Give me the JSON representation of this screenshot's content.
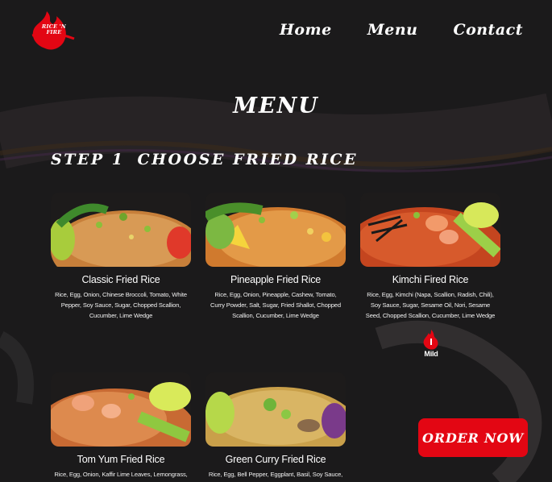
{
  "brand": {
    "logo_text": "RICE 'N FIRE",
    "accent": "#e30613"
  },
  "nav": {
    "items": [
      "Home",
      "Menu",
      "Contact"
    ]
  },
  "page_title": "Menu",
  "step": {
    "number": "Step 1",
    "title": "Choose Fried Rice"
  },
  "cards": [
    {
      "name": "Classic Fried Rice",
      "ingredients": "Rice, Egg, Onion, Chinese Broccoli, Tomato, White Pepper, Soy Sauce, Sugar, Chopped Scallion, Cucumber, Lime Wedge"
    },
    {
      "name": "Pineapple Fried Rice",
      "ingredients": "Rice, Egg, Onion, Pineapple, Cashew, Tomato, Curry Powder, Salt, Sugar, Fried Shallot, Chopped Scallion, Cucumber, Lime Wedge"
    },
    {
      "name": "Kimchi Fired Rice",
      "ingredients": "Rice, Egg, Kimchi (Napa, Scallion, Radish, Chili), Soy Sauce, Sugar, Sesame Oil, Nori, Sesame Seed, Chopped Scallion, Cucumber, Lime Wedge",
      "badge": "Mild"
    },
    {
      "name": "Tom Yum Fried Rice",
      "ingredients": "Rice, Egg, Onion, Kaffir Lime Leaves, Lemongrass, Soy Sauce, Sugar, Chili, Chopped Scallion, Cucumber, Lime Wedge"
    },
    {
      "name": "Green Curry Fried Rice",
      "ingredients": "Rice, Egg, Bell Pepper, Eggplant, Basil, Soy Sauce, Green Curry Paste, Chopped Scallion, Cucumber, Lime Wedge"
    }
  ],
  "cta": {
    "label": "Order Now"
  }
}
